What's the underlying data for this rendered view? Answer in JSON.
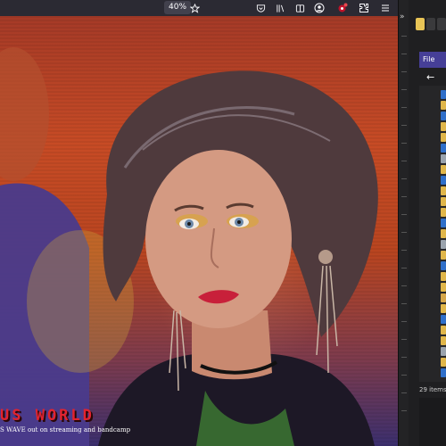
{
  "browser": {
    "zoom": "40%",
    "icons": [
      "bookmark-star-icon",
      "pocket-icon",
      "library-icon",
      "reader-view-icon",
      "account-icon",
      "extension-badge-icon",
      "extensions-icon",
      "menu-icon"
    ]
  },
  "page": {
    "title": "US WORLD",
    "caption": "S WAVE out on streaming and bandcamp"
  },
  "file_manager": {
    "menu_label": "File",
    "nav_back": "←",
    "status": "29 items",
    "row_icon_colors": [
      "#2f6fc9",
      "#e0b64a",
      "#2f6fc9",
      "#e0b64a",
      "#e0b64a",
      "#2f6fc9",
      "#9aa3ad",
      "#e0b64a",
      "#2f6fc9",
      "#e0b64a",
      "#e0b64a",
      "#e0b64a",
      "#2f6fc9",
      "#e0b64a",
      "#9aa3ad",
      "#e0b64a",
      "#2f6fc9",
      "#e0b64a",
      "#e0b64a",
      "#d4a64a",
      "#e0b64a",
      "#2f6fc9",
      "#e0b64a",
      "#e0b64a",
      "#9aa3ad",
      "#e0b64a",
      "#2f6fc9"
    ]
  },
  "colors": {
    "accent_menu": "#463f97",
    "title_red": "#e2232e"
  }
}
